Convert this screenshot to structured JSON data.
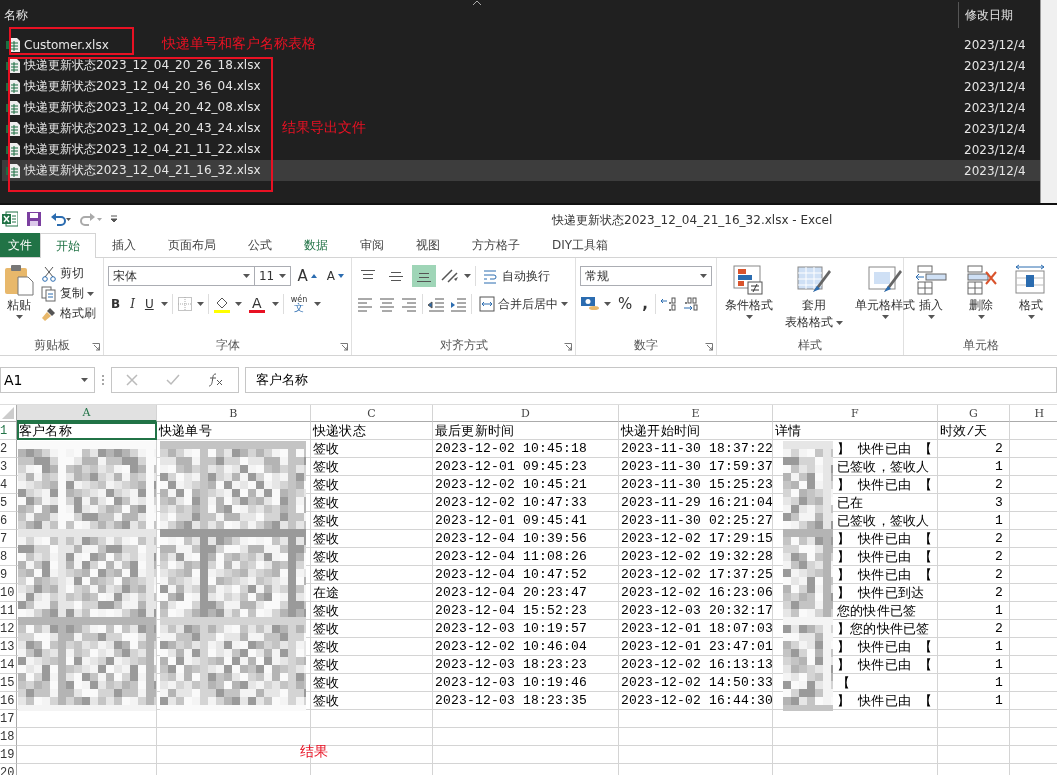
{
  "explorer": {
    "columns": [
      "名称",
      "修改日期"
    ],
    "files": [
      {
        "name": "Customer.xlsx",
        "modified": "2023/12/4",
        "selected": false,
        "annotation": "快递单号和客户名称表格"
      },
      {
        "name": "快递更新状态2023_12_04_20_26_18.xlsx",
        "modified": "2023/12/4",
        "selected": false
      },
      {
        "name": "快递更新状态2023_12_04_20_36_04.xlsx",
        "modified": "2023/12/4",
        "selected": false
      },
      {
        "name": "快递更新状态2023_12_04_20_42_08.xlsx",
        "modified": "2023/12/4",
        "selected": false
      },
      {
        "name": "快递更新状态2023_12_04_20_43_24.xlsx",
        "modified": "2023/12/4",
        "selected": false,
        "annotation": "结果导出文件"
      },
      {
        "name": "快递更新状态2023_12_04_21_11_22.xlsx",
        "modified": "2023/12/4",
        "selected": false
      },
      {
        "name": "快递更新状态2023_12_04_21_16_32.xlsx",
        "modified": "2023/12/4",
        "selected": true
      }
    ]
  },
  "excel": {
    "title": "快递更新状态2023_12_04_21_16_32.xlsx - Excel",
    "tabs": [
      {
        "label": "文件",
        "kind": "file",
        "selected": false
      },
      {
        "label": "开始",
        "kind": "tab",
        "selected": true
      },
      {
        "label": "插入",
        "kind": "tab",
        "selected": false
      },
      {
        "label": "页面布局",
        "kind": "tab",
        "selected": false
      },
      {
        "label": "公式",
        "kind": "tab",
        "selected": false
      },
      {
        "label": "数据",
        "kind": "accent",
        "selected": false
      },
      {
        "label": "审阅",
        "kind": "tab",
        "selected": false
      },
      {
        "label": "视图",
        "kind": "tab",
        "selected": false
      },
      {
        "label": "方方格子",
        "kind": "tab",
        "selected": false
      },
      {
        "label": "DIY工具箱",
        "kind": "tab",
        "selected": false
      }
    ],
    "ribbon": {
      "clipboard": {
        "label": "剪贴板",
        "paste": "粘贴",
        "cut": "剪切",
        "copy": "复制",
        "painter": "格式刷"
      },
      "font": {
        "label": "字体",
        "name": "宋体",
        "size": "11",
        "grow": "A",
        "shrink": "A",
        "bold": "B",
        "italic": "I",
        "underline": "U",
        "font_color": "A",
        "phonetic": "wén",
        "phonetic_sub": "文"
      },
      "alignment": {
        "label": "对齐方式",
        "vertical": [
          {
            "kind": "top",
            "selected": false
          },
          {
            "kind": "middle",
            "selected": false
          },
          {
            "kind": "bottom",
            "selected": true
          }
        ],
        "wrap": "自动换行",
        "merge": "合并后居中"
      },
      "number": {
        "label": "数字",
        "format": "常规",
        "percent": "%",
        "comma": ","
      },
      "styles": {
        "label": "样式",
        "buttons": [
          {
            "kind": "conditional",
            "label": "条件格式"
          },
          {
            "kind": "table",
            "label": "套用",
            "label2": "表格格式"
          },
          {
            "kind": "cellstyle",
            "label": "单元格样式"
          }
        ]
      },
      "cells": {
        "label": "单元格",
        "buttons": [
          {
            "kind": "insert",
            "label": "插入"
          },
          {
            "kind": "delete",
            "label": "删除"
          },
          {
            "kind": "format",
            "label": "格式"
          }
        ]
      }
    },
    "name_box": "A1",
    "formula": "客户名称",
    "sheet": {
      "columns": [
        {
          "letter": "A",
          "selected": true
        },
        {
          "letter": "B",
          "selected": false
        },
        {
          "letter": "C",
          "selected": false
        },
        {
          "letter": "D",
          "selected": false
        },
        {
          "letter": "E",
          "selected": false
        },
        {
          "letter": "F",
          "selected": false
        },
        {
          "letter": "G",
          "selected": false
        },
        {
          "letter": "H",
          "selected": false
        }
      ],
      "header": [
        "客户名称",
        "快递单号",
        "快递状态",
        "最后更新时间",
        "快递开始时间",
        "详情",
        "时效/天"
      ],
      "rows": [
        {
          "status": "签收",
          "last_update": "2023-12-02 10:45:18",
          "start": "2023-11-30 18:37:22",
          "detail": "】 快件已由 【",
          "days": "2"
        },
        {
          "status": "签收",
          "last_update": "2023-12-01 09:45:23",
          "start": "2023-11-30 17:59:37",
          "detail": "已签收，签收人",
          "days": "1"
        },
        {
          "status": "签收",
          "last_update": "2023-12-02 10:45:21",
          "start": "2023-11-30 15:25:23",
          "detail": "】 快件已由 【",
          "days": "2"
        },
        {
          "status": "签收",
          "last_update": "2023-12-02 10:47:33",
          "start": "2023-11-29 16:21:04",
          "detail": "已在",
          "days": "3"
        },
        {
          "status": "签收",
          "last_update": "2023-12-01 09:45:41",
          "start": "2023-11-30 02:25:27",
          "detail": "已签收，签收人",
          "days": "1"
        },
        {
          "status": "签收",
          "last_update": "2023-12-04 10:39:56",
          "start": "2023-12-02 17:29:15",
          "detail": "】 快件已由 【",
          "days": "2"
        },
        {
          "status": "签收",
          "last_update": "2023-12-04 11:08:26",
          "start": "2023-12-02 19:32:28",
          "detail": "】 快件已由 【",
          "days": "2"
        },
        {
          "status": "签收",
          "last_update": "2023-12-04 10:47:52",
          "start": "2023-12-02 17:37:25",
          "detail": "】 快件已由 【",
          "days": "2"
        },
        {
          "status": "在途",
          "last_update": "2023-12-04 20:23:47",
          "start": "2023-12-02 16:23:06",
          "detail": "】 快件已到达",
          "days": "2"
        },
        {
          "status": "签收",
          "last_update": "2023-12-04 15:52:23",
          "start": "2023-12-03 20:32:17",
          "detail": "您的快件已签",
          "days": "1"
        },
        {
          "status": "签收",
          "last_update": "2023-12-03 10:19:57",
          "start": "2023-12-01 18:07:03",
          "detail": "】您的快件已签",
          "days": "2"
        },
        {
          "status": "签收",
          "last_update": "2023-12-02 10:46:04",
          "start": "2023-12-01 23:47:01",
          "detail": "】 快件已由 【",
          "days": "1"
        },
        {
          "status": "签收",
          "last_update": "2023-12-03 18:23:23",
          "start": "2023-12-02 16:13:13",
          "detail": "】 快件已由 【",
          "days": "1"
        },
        {
          "status": "签收",
          "last_update": "2023-12-03 10:19:46",
          "start": "2023-12-02 14:50:33",
          "detail": "【",
          "days": "1"
        },
        {
          "status": "签收",
          "last_update": "2023-12-03 18:23:35",
          "start": "2023-12-02 16:44:30",
          "detail": "】 快件已由 【",
          "days": "1"
        }
      ],
      "row_numbers": [
        "1",
        "2",
        "3",
        "4",
        "5",
        "6",
        "7",
        "8",
        "9",
        "10",
        "11",
        "12",
        "13",
        "14",
        "15",
        "16"
      ],
      "empty_rows": [
        "17",
        "18",
        "19",
        "20"
      ],
      "annotation": "结果"
    }
  }
}
